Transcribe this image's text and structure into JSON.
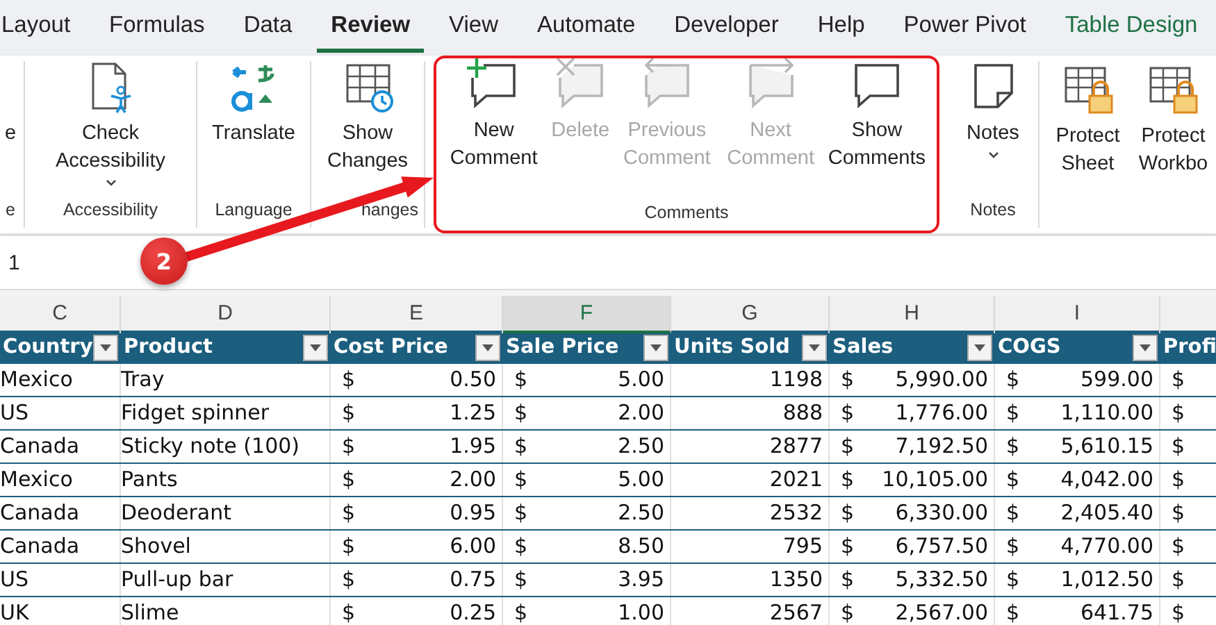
{
  "tabs": [
    {
      "label": "Layout",
      "selected": false,
      "kind": "normal"
    },
    {
      "label": "Formulas",
      "selected": false,
      "kind": "normal"
    },
    {
      "label": "Data",
      "selected": false,
      "kind": "normal"
    },
    {
      "label": "Review",
      "selected": true,
      "kind": "normal"
    },
    {
      "label": "View",
      "selected": false,
      "kind": "normal"
    },
    {
      "label": "Automate",
      "selected": false,
      "kind": "normal"
    },
    {
      "label": "Developer",
      "selected": false,
      "kind": "normal"
    },
    {
      "label": "Help",
      "selected": false,
      "kind": "normal"
    },
    {
      "label": "Power Pivot",
      "selected": false,
      "kind": "normal"
    },
    {
      "label": "Table Design",
      "selected": false,
      "kind": "contextual"
    }
  ],
  "ribbon_groups": [
    {
      "label": "e",
      "highlighted": false,
      "buttons": [
        {
          "label": "e",
          "kind": "plain",
          "disabled": false,
          "dropdown": false
        }
      ]
    },
    {
      "label": "Accessibility",
      "highlighted": false,
      "buttons": [
        {
          "label": "Check Accessibility",
          "kind": "accessibility",
          "disabled": false,
          "dropdown": true
        }
      ]
    },
    {
      "label": "Language",
      "highlighted": false,
      "buttons": [
        {
          "label": "Translate",
          "kind": "translate",
          "disabled": false,
          "dropdown": false
        }
      ]
    },
    {
      "label": "hanges",
      "highlighted": false,
      "buttons": [
        {
          "label": "Show Changes",
          "kind": "changes",
          "disabled": false,
          "dropdown": false
        }
      ]
    },
    {
      "label": "Comments",
      "highlighted": true,
      "buttons": [
        {
          "label": "New Comment",
          "kind": "add",
          "disabled": false,
          "dropdown": false
        },
        {
          "label": "Delete",
          "kind": "delete",
          "disabled": true,
          "dropdown": false
        },
        {
          "label": "Previous Comment",
          "kind": "previous",
          "disabled": true,
          "dropdown": false
        },
        {
          "label": "Next Comment",
          "kind": "next",
          "disabled": true,
          "dropdown": false
        },
        {
          "label": "Show Comments",
          "kind": "comments",
          "disabled": false,
          "dropdown": false
        }
      ]
    },
    {
      "label": "Notes",
      "highlighted": false,
      "buttons": [
        {
          "label": "Notes",
          "kind": "notes",
          "disabled": false,
          "dropdown": true
        }
      ]
    },
    {
      "highlighted": false,
      "buttons": [
        {
          "label": "Protect Sheet",
          "kind": "protect",
          "disabled": false,
          "dropdown": false
        },
        {
          "label": "Protect Workbo",
          "kind": "protect",
          "disabled": false,
          "dropdown": false
        }
      ]
    }
  ],
  "callout": {
    "number": "2"
  },
  "formula_bar": {
    "value": "1"
  },
  "column_letters": [
    {
      "label": "C",
      "selected": false
    },
    {
      "label": "D",
      "selected": false
    },
    {
      "label": "E",
      "selected": false
    },
    {
      "label": "F",
      "selected": true
    },
    {
      "label": "G",
      "selected": false
    },
    {
      "label": "H",
      "selected": false
    },
    {
      "label": "I",
      "selected": false
    }
  ],
  "table": {
    "columns": [
      {
        "label": "Country",
        "kind": "text",
        "filter": true
      },
      {
        "label": "Product",
        "kind": "text",
        "filter": true
      },
      {
        "label": "Cost Price",
        "kind": "currency",
        "filter": true
      },
      {
        "label": "Sale Price",
        "kind": "currency",
        "filter": true
      },
      {
        "label": "Units Sold",
        "kind": "number",
        "filter": true
      },
      {
        "label": "Sales",
        "kind": "currency",
        "filter": true
      },
      {
        "label": "COGS",
        "kind": "currency",
        "filter": true
      },
      {
        "label": "Profi",
        "kind": "currency",
        "filter": false
      }
    ],
    "rows": [
      [
        {
          "text": "Mexico"
        },
        {
          "text": "Tray"
        },
        {
          "symbol": "$",
          "amount": "0.50"
        },
        {
          "symbol": "$",
          "amount": "5.00"
        },
        {
          "text": "1198"
        },
        {
          "symbol": "$",
          "amount": "5,990.00"
        },
        {
          "symbol": "$",
          "amount": "599.00"
        },
        {
          "symbol": "$"
        }
      ],
      [
        {
          "text": "US"
        },
        {
          "text": "Fidget spinner"
        },
        {
          "symbol": "$",
          "amount": "1.25"
        },
        {
          "symbol": "$",
          "amount": "2.00"
        },
        {
          "text": "888"
        },
        {
          "symbol": "$",
          "amount": "1,776.00"
        },
        {
          "symbol": "$",
          "amount": "1,110.00"
        },
        {
          "symbol": "$"
        }
      ],
      [
        {
          "text": "Canada"
        },
        {
          "text": "Sticky note (100)"
        },
        {
          "symbol": "$",
          "amount": "1.95"
        },
        {
          "symbol": "$",
          "amount": "2.50"
        },
        {
          "text": "2877"
        },
        {
          "symbol": "$",
          "amount": "7,192.50"
        },
        {
          "symbol": "$",
          "amount": "5,610.15"
        },
        {
          "symbol": "$"
        }
      ],
      [
        {
          "text": "Mexico"
        },
        {
          "text": "Pants"
        },
        {
          "symbol": "$",
          "amount": "2.00"
        },
        {
          "symbol": "$",
          "amount": "5.00"
        },
        {
          "text": "2021"
        },
        {
          "symbol": "$",
          "amount": "10,105.00"
        },
        {
          "symbol": "$",
          "amount": "4,042.00"
        },
        {
          "symbol": "$"
        }
      ],
      [
        {
          "text": "Canada"
        },
        {
          "text": "Deoderant"
        },
        {
          "symbol": "$",
          "amount": "0.95"
        },
        {
          "symbol": "$",
          "amount": "2.50"
        },
        {
          "text": "2532"
        },
        {
          "symbol": "$",
          "amount": "6,330.00"
        },
        {
          "symbol": "$",
          "amount": "2,405.40"
        },
        {
          "symbol": "$"
        }
      ],
      [
        {
          "text": "Canada"
        },
        {
          "text": "Shovel"
        },
        {
          "symbol": "$",
          "amount": "6.00"
        },
        {
          "symbol": "$",
          "amount": "8.50"
        },
        {
          "text": "795"
        },
        {
          "symbol": "$",
          "amount": "6,757.50"
        },
        {
          "symbol": "$",
          "amount": "4,770.00"
        },
        {
          "symbol": "$"
        }
      ],
      [
        {
          "text": "US"
        },
        {
          "text": "Pull-up bar"
        },
        {
          "symbol": "$",
          "amount": "0.75"
        },
        {
          "symbol": "$",
          "amount": "3.95"
        },
        {
          "text": "1350"
        },
        {
          "symbol": "$",
          "amount": "5,332.50"
        },
        {
          "symbol": "$",
          "amount": "1,012.50"
        },
        {
          "symbol": "$"
        }
      ],
      [
        {
          "text": "UK"
        },
        {
          "text": "Slime"
        },
        {
          "symbol": "$",
          "amount": "0.25"
        },
        {
          "symbol": "$",
          "amount": "1.00"
        },
        {
          "text": "2567"
        },
        {
          "symbol": "$",
          "amount": "2,567.00"
        },
        {
          "symbol": "$",
          "amount": "641.75"
        },
        {
          "symbol": "$"
        }
      ]
    ]
  }
}
